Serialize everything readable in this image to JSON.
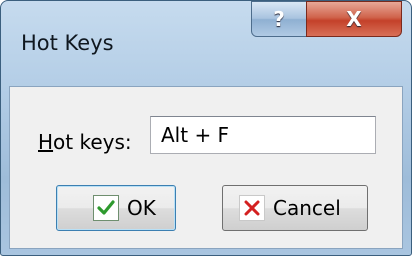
{
  "window": {
    "title": "Hot Keys"
  },
  "caption_buttons": {
    "help_label": "?",
    "close_label": "X"
  },
  "form": {
    "label_accelerator": "H",
    "label_rest": "ot keys:",
    "hotkey_value": "Alt + F"
  },
  "buttons": {
    "ok_label": "OK",
    "cancel_label": "Cancel"
  },
  "icons": {
    "ok": "checkmark-icon",
    "cancel": "red-x-icon"
  },
  "colors": {
    "checkmark": "#2e9a2e",
    "cancel_x": "#d42020",
    "close_button": "#c4412a"
  }
}
